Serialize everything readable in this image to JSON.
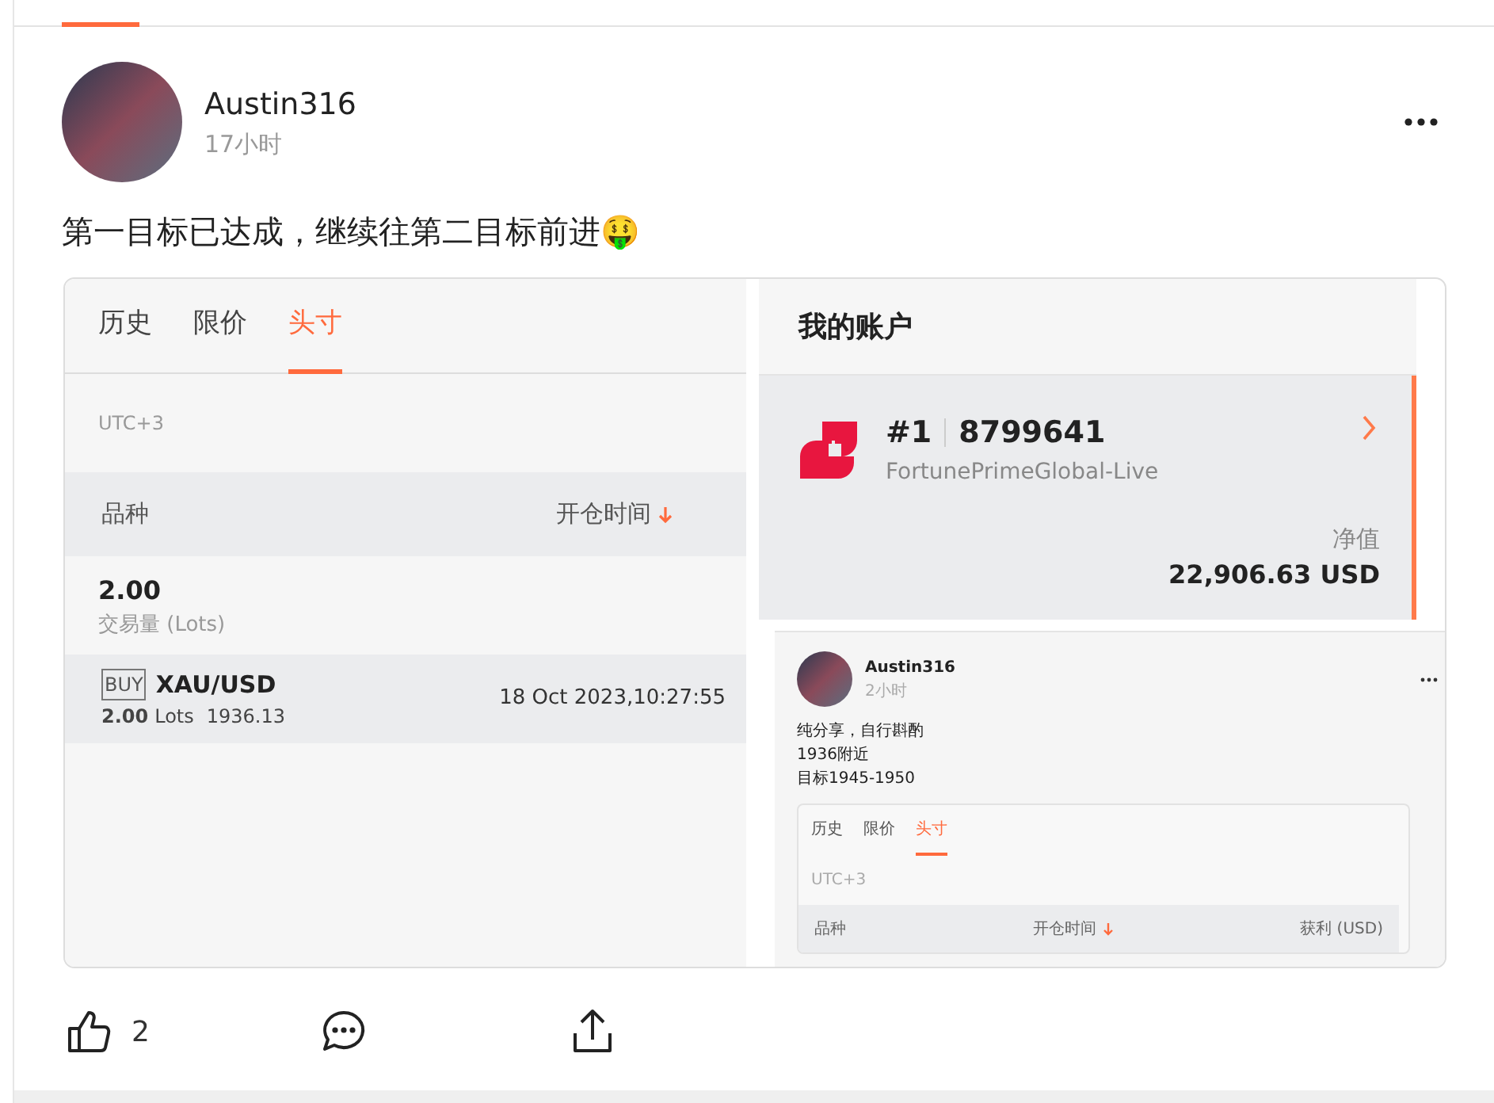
{
  "post": {
    "author": "Austin316",
    "time": "17小时",
    "text": "第一目标已达成，继续往第二目标前进🤑"
  },
  "screenshot": {
    "left": {
      "tabs": [
        {
          "label": "历史",
          "selected": false
        },
        {
          "label": "限价",
          "selected": false
        },
        {
          "label": "头寸",
          "selected": true
        }
      ],
      "timezone": "UTC+3",
      "columns": [
        "品种",
        "开仓时间"
      ],
      "summary": {
        "value": "2.00",
        "label": "交易量 (Lots)"
      },
      "positions": [
        {
          "side": "BUY",
          "symbol": "XAU/USD",
          "lots": "2.00",
          "unit": "Lots",
          "price": "1936.13",
          "open_time": "18 Oct 2023,10:27:55"
        }
      ]
    },
    "right": {
      "title": "我的账户",
      "account": {
        "number": "#1",
        "id": "8799641",
        "server": "FortunePrimeGlobal-Live",
        "equity_label": "净值",
        "equity": "22,906.63 USD"
      }
    },
    "nested_post": {
      "author": "Austin316",
      "time": "2小时",
      "lines": [
        "纯分享，自行斟酌",
        "1936附近",
        "目标1945-1950"
      ],
      "tabs": [
        {
          "label": "历史",
          "selected": false
        },
        {
          "label": "限价",
          "selected": false
        },
        {
          "label": "头寸",
          "selected": true
        }
      ],
      "timezone": "UTC+3",
      "columns": [
        "品种",
        "开仓时间",
        "获利 (USD)"
      ]
    }
  },
  "actions": {
    "likes": "2"
  }
}
